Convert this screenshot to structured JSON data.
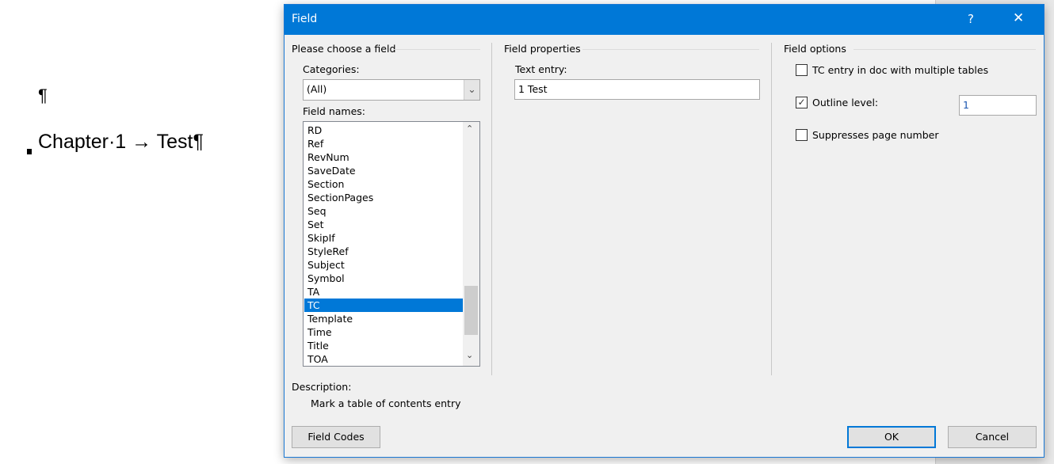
{
  "document": {
    "empty_paragraph": "¶",
    "heading": "Chapter·1 → Test¶"
  },
  "dialog": {
    "title": "Field",
    "help": "?",
    "close": "✕",
    "choose": {
      "heading": "Please choose a field",
      "categories_label": "Categories:",
      "categories_value": "(All)",
      "field_names_label": "Field names:",
      "items": [
        "RD",
        "Ref",
        "RevNum",
        "SaveDate",
        "Section",
        "SectionPages",
        "Seq",
        "Set",
        "SkipIf",
        "StyleRef",
        "Subject",
        "Symbol",
        "TA",
        "TC",
        "Template",
        "Time",
        "Title",
        "TOA"
      ],
      "selected": "TC"
    },
    "properties": {
      "heading": "Field properties",
      "text_entry_label": "Text entry:",
      "text_entry_value": "1 Test"
    },
    "options": {
      "heading": "Field options",
      "tc_multiple": "TC entry in doc with multiple tables",
      "tc_multiple_checked": false,
      "outline_label": "Outline level:",
      "outline_checked": true,
      "outline_value": "1",
      "suppress": "Suppresses page number",
      "suppress_checked": false
    },
    "description_label": "Description:",
    "description": "Mark a table of contents entry",
    "field_codes": "Field Codes",
    "ok": "OK",
    "cancel": "Cancel"
  },
  "colors": {
    "accent": "#0078d7"
  }
}
